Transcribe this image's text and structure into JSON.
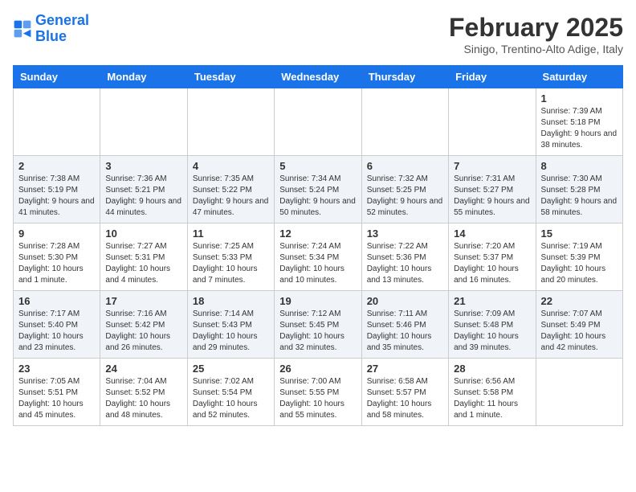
{
  "logo": {
    "line1": "General",
    "line2": "Blue"
  },
  "title": "February 2025",
  "subtitle": "Sinigo, Trentino-Alto Adige, Italy",
  "weekdays": [
    "Sunday",
    "Monday",
    "Tuesday",
    "Wednesday",
    "Thursday",
    "Friday",
    "Saturday"
  ],
  "weeks": [
    [
      {
        "day": "",
        "info": ""
      },
      {
        "day": "",
        "info": ""
      },
      {
        "day": "",
        "info": ""
      },
      {
        "day": "",
        "info": ""
      },
      {
        "day": "",
        "info": ""
      },
      {
        "day": "",
        "info": ""
      },
      {
        "day": "1",
        "info": "Sunrise: 7:39 AM\nSunset: 5:18 PM\nDaylight: 9 hours and 38 minutes."
      }
    ],
    [
      {
        "day": "2",
        "info": "Sunrise: 7:38 AM\nSunset: 5:19 PM\nDaylight: 9 hours and 41 minutes."
      },
      {
        "day": "3",
        "info": "Sunrise: 7:36 AM\nSunset: 5:21 PM\nDaylight: 9 hours and 44 minutes."
      },
      {
        "day": "4",
        "info": "Sunrise: 7:35 AM\nSunset: 5:22 PM\nDaylight: 9 hours and 47 minutes."
      },
      {
        "day": "5",
        "info": "Sunrise: 7:34 AM\nSunset: 5:24 PM\nDaylight: 9 hours and 50 minutes."
      },
      {
        "day": "6",
        "info": "Sunrise: 7:32 AM\nSunset: 5:25 PM\nDaylight: 9 hours and 52 minutes."
      },
      {
        "day": "7",
        "info": "Sunrise: 7:31 AM\nSunset: 5:27 PM\nDaylight: 9 hours and 55 minutes."
      },
      {
        "day": "8",
        "info": "Sunrise: 7:30 AM\nSunset: 5:28 PM\nDaylight: 9 hours and 58 minutes."
      }
    ],
    [
      {
        "day": "9",
        "info": "Sunrise: 7:28 AM\nSunset: 5:30 PM\nDaylight: 10 hours and 1 minute."
      },
      {
        "day": "10",
        "info": "Sunrise: 7:27 AM\nSunset: 5:31 PM\nDaylight: 10 hours and 4 minutes."
      },
      {
        "day": "11",
        "info": "Sunrise: 7:25 AM\nSunset: 5:33 PM\nDaylight: 10 hours and 7 minutes."
      },
      {
        "day": "12",
        "info": "Sunrise: 7:24 AM\nSunset: 5:34 PM\nDaylight: 10 hours and 10 minutes."
      },
      {
        "day": "13",
        "info": "Sunrise: 7:22 AM\nSunset: 5:36 PM\nDaylight: 10 hours and 13 minutes."
      },
      {
        "day": "14",
        "info": "Sunrise: 7:20 AM\nSunset: 5:37 PM\nDaylight: 10 hours and 16 minutes."
      },
      {
        "day": "15",
        "info": "Sunrise: 7:19 AM\nSunset: 5:39 PM\nDaylight: 10 hours and 20 minutes."
      }
    ],
    [
      {
        "day": "16",
        "info": "Sunrise: 7:17 AM\nSunset: 5:40 PM\nDaylight: 10 hours and 23 minutes."
      },
      {
        "day": "17",
        "info": "Sunrise: 7:16 AM\nSunset: 5:42 PM\nDaylight: 10 hours and 26 minutes."
      },
      {
        "day": "18",
        "info": "Sunrise: 7:14 AM\nSunset: 5:43 PM\nDaylight: 10 hours and 29 minutes."
      },
      {
        "day": "19",
        "info": "Sunrise: 7:12 AM\nSunset: 5:45 PM\nDaylight: 10 hours and 32 minutes."
      },
      {
        "day": "20",
        "info": "Sunrise: 7:11 AM\nSunset: 5:46 PM\nDaylight: 10 hours and 35 minutes."
      },
      {
        "day": "21",
        "info": "Sunrise: 7:09 AM\nSunset: 5:48 PM\nDaylight: 10 hours and 39 minutes."
      },
      {
        "day": "22",
        "info": "Sunrise: 7:07 AM\nSunset: 5:49 PM\nDaylight: 10 hours and 42 minutes."
      }
    ],
    [
      {
        "day": "23",
        "info": "Sunrise: 7:05 AM\nSunset: 5:51 PM\nDaylight: 10 hours and 45 minutes."
      },
      {
        "day": "24",
        "info": "Sunrise: 7:04 AM\nSunset: 5:52 PM\nDaylight: 10 hours and 48 minutes."
      },
      {
        "day": "25",
        "info": "Sunrise: 7:02 AM\nSunset: 5:54 PM\nDaylight: 10 hours and 52 minutes."
      },
      {
        "day": "26",
        "info": "Sunrise: 7:00 AM\nSunset: 5:55 PM\nDaylight: 10 hours and 55 minutes."
      },
      {
        "day": "27",
        "info": "Sunrise: 6:58 AM\nSunset: 5:57 PM\nDaylight: 10 hours and 58 minutes."
      },
      {
        "day": "28",
        "info": "Sunrise: 6:56 AM\nSunset: 5:58 PM\nDaylight: 11 hours and 1 minute."
      },
      {
        "day": "",
        "info": ""
      }
    ]
  ]
}
